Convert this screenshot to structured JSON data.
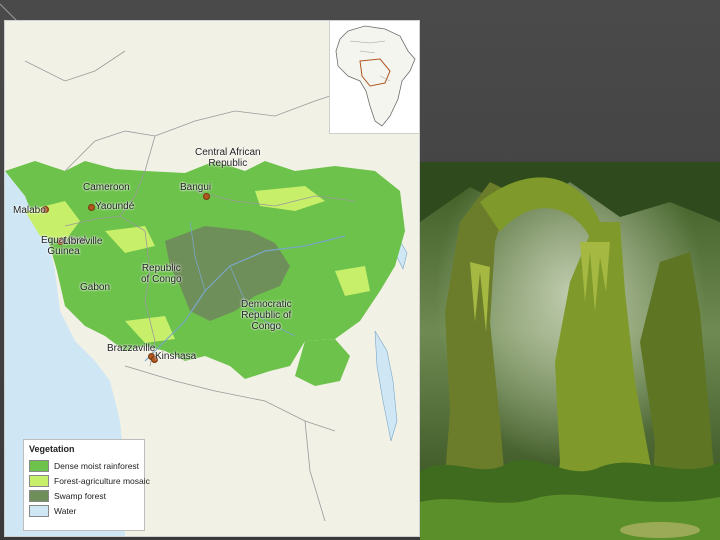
{
  "map": {
    "labels": {
      "central_african_republic": "Central African\nRepublic",
      "cameroon": "Cameroon",
      "bangui": "Bangui",
      "malabo": "Malabo",
      "yaounde": "Yaoundé",
      "equatorial_guinea": "Equatorial\nGuinea",
      "libreville": "Libreville",
      "republic_of_congo": "Republic\nof Congo",
      "gabon": "Gabon",
      "drc": "Democratic\nRepublic of\nCongo",
      "brazzaville": "Brazzaville",
      "kinshasa": "Kinshasa"
    },
    "legend": {
      "title": "Vegetation",
      "items": [
        {
          "label": "Dense moist rainforest",
          "color": "#6cc24a"
        },
        {
          "label": "Forest-agriculture mosaic",
          "color": "#c7ef6a"
        },
        {
          "label": "Swamp forest",
          "color": "#6f8f5a"
        },
        {
          "label": "Water",
          "color": "#cfe7f5"
        }
      ]
    },
    "colors": {
      "land": "#f2f1e6",
      "ocean": "#cfe7f5",
      "rainforest": "#6cc24a",
      "mosaic": "#c7ef6a",
      "swamp": "#6f8f5a",
      "border": "#9a9a9a",
      "city": "#b0561f"
    },
    "inset_label": "locator-map-of-africa"
  },
  "photo": {
    "subject": "moss-covered-rainforest-trees",
    "colors": {
      "canopy": "#2f4a1c",
      "moss": "#7f9a2a",
      "mist": "#c9d3b8",
      "trunk": "#6b7d2a"
    }
  }
}
